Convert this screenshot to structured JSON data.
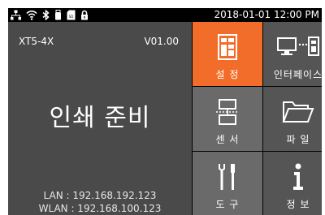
{
  "statusbar": {
    "icons": [
      "network-icon",
      "wifi-icon",
      "bluetooth-icon",
      "usb-icon",
      "sd-card-icon",
      "lock-icon"
    ],
    "datetime": "2018-01-01 12:00 PM"
  },
  "device": {
    "model": "XT5-4X",
    "version": "V01.00",
    "status": "인쇄 준비",
    "lan": "LAN : 192.168.192.123",
    "wlan": "WLAN : 192.168.100.123"
  },
  "menu": {
    "settings_label": "설 정",
    "interface_label": "인터페이스",
    "sensor_label": "센 서",
    "file_label": "파 일",
    "tools_label": "도 구",
    "info_label": "정 보"
  },
  "colors": {
    "accent": "#f36d2a",
    "panel": "#4a4a4a",
    "tile_dark": "#555555",
    "tile_light": "#6a6a6a",
    "background": "#000000"
  }
}
